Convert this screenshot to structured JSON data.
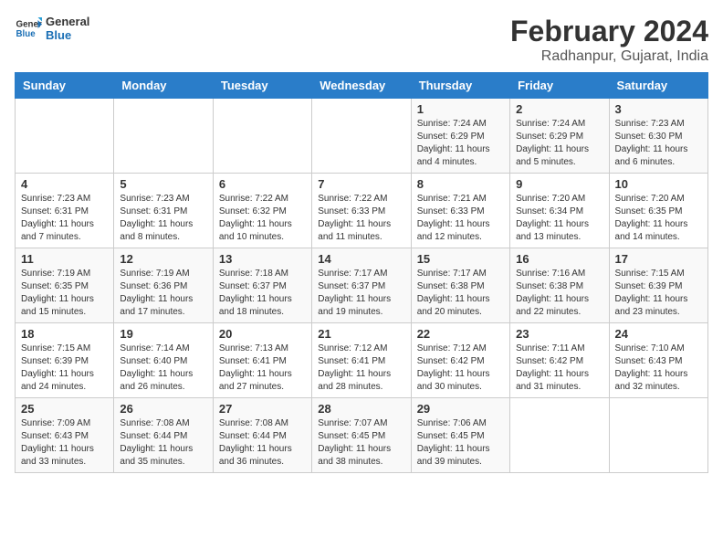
{
  "logo": {
    "line1": "General",
    "line2": "Blue"
  },
  "title": "February 2024",
  "subtitle": "Radhanpur, Gujarat, India",
  "days_of_week": [
    "Sunday",
    "Monday",
    "Tuesday",
    "Wednesday",
    "Thursday",
    "Friday",
    "Saturday"
  ],
  "weeks": [
    [
      {
        "day": "",
        "info": ""
      },
      {
        "day": "",
        "info": ""
      },
      {
        "day": "",
        "info": ""
      },
      {
        "day": "",
        "info": ""
      },
      {
        "day": "1",
        "info": "Sunrise: 7:24 AM\nSunset: 6:29 PM\nDaylight: 11 hours and 4 minutes."
      },
      {
        "day": "2",
        "info": "Sunrise: 7:24 AM\nSunset: 6:29 PM\nDaylight: 11 hours and 5 minutes."
      },
      {
        "day": "3",
        "info": "Sunrise: 7:23 AM\nSunset: 6:30 PM\nDaylight: 11 hours and 6 minutes."
      }
    ],
    [
      {
        "day": "4",
        "info": "Sunrise: 7:23 AM\nSunset: 6:31 PM\nDaylight: 11 hours and 7 minutes."
      },
      {
        "day": "5",
        "info": "Sunrise: 7:23 AM\nSunset: 6:31 PM\nDaylight: 11 hours and 8 minutes."
      },
      {
        "day": "6",
        "info": "Sunrise: 7:22 AM\nSunset: 6:32 PM\nDaylight: 11 hours and 10 minutes."
      },
      {
        "day": "7",
        "info": "Sunrise: 7:22 AM\nSunset: 6:33 PM\nDaylight: 11 hours and 11 minutes."
      },
      {
        "day": "8",
        "info": "Sunrise: 7:21 AM\nSunset: 6:33 PM\nDaylight: 11 hours and 12 minutes."
      },
      {
        "day": "9",
        "info": "Sunrise: 7:20 AM\nSunset: 6:34 PM\nDaylight: 11 hours and 13 minutes."
      },
      {
        "day": "10",
        "info": "Sunrise: 7:20 AM\nSunset: 6:35 PM\nDaylight: 11 hours and 14 minutes."
      }
    ],
    [
      {
        "day": "11",
        "info": "Sunrise: 7:19 AM\nSunset: 6:35 PM\nDaylight: 11 hours and 15 minutes."
      },
      {
        "day": "12",
        "info": "Sunrise: 7:19 AM\nSunset: 6:36 PM\nDaylight: 11 hours and 17 minutes."
      },
      {
        "day": "13",
        "info": "Sunrise: 7:18 AM\nSunset: 6:37 PM\nDaylight: 11 hours and 18 minutes."
      },
      {
        "day": "14",
        "info": "Sunrise: 7:17 AM\nSunset: 6:37 PM\nDaylight: 11 hours and 19 minutes."
      },
      {
        "day": "15",
        "info": "Sunrise: 7:17 AM\nSunset: 6:38 PM\nDaylight: 11 hours and 20 minutes."
      },
      {
        "day": "16",
        "info": "Sunrise: 7:16 AM\nSunset: 6:38 PM\nDaylight: 11 hours and 22 minutes."
      },
      {
        "day": "17",
        "info": "Sunrise: 7:15 AM\nSunset: 6:39 PM\nDaylight: 11 hours and 23 minutes."
      }
    ],
    [
      {
        "day": "18",
        "info": "Sunrise: 7:15 AM\nSunset: 6:39 PM\nDaylight: 11 hours and 24 minutes."
      },
      {
        "day": "19",
        "info": "Sunrise: 7:14 AM\nSunset: 6:40 PM\nDaylight: 11 hours and 26 minutes."
      },
      {
        "day": "20",
        "info": "Sunrise: 7:13 AM\nSunset: 6:41 PM\nDaylight: 11 hours and 27 minutes."
      },
      {
        "day": "21",
        "info": "Sunrise: 7:12 AM\nSunset: 6:41 PM\nDaylight: 11 hours and 28 minutes."
      },
      {
        "day": "22",
        "info": "Sunrise: 7:12 AM\nSunset: 6:42 PM\nDaylight: 11 hours and 30 minutes."
      },
      {
        "day": "23",
        "info": "Sunrise: 7:11 AM\nSunset: 6:42 PM\nDaylight: 11 hours and 31 minutes."
      },
      {
        "day": "24",
        "info": "Sunrise: 7:10 AM\nSunset: 6:43 PM\nDaylight: 11 hours and 32 minutes."
      }
    ],
    [
      {
        "day": "25",
        "info": "Sunrise: 7:09 AM\nSunset: 6:43 PM\nDaylight: 11 hours and 33 minutes."
      },
      {
        "day": "26",
        "info": "Sunrise: 7:08 AM\nSunset: 6:44 PM\nDaylight: 11 hours and 35 minutes."
      },
      {
        "day": "27",
        "info": "Sunrise: 7:08 AM\nSunset: 6:44 PM\nDaylight: 11 hours and 36 minutes."
      },
      {
        "day": "28",
        "info": "Sunrise: 7:07 AM\nSunset: 6:45 PM\nDaylight: 11 hours and 38 minutes."
      },
      {
        "day": "29",
        "info": "Sunrise: 7:06 AM\nSunset: 6:45 PM\nDaylight: 11 hours and 39 minutes."
      },
      {
        "day": "",
        "info": ""
      },
      {
        "day": "",
        "info": ""
      }
    ]
  ]
}
